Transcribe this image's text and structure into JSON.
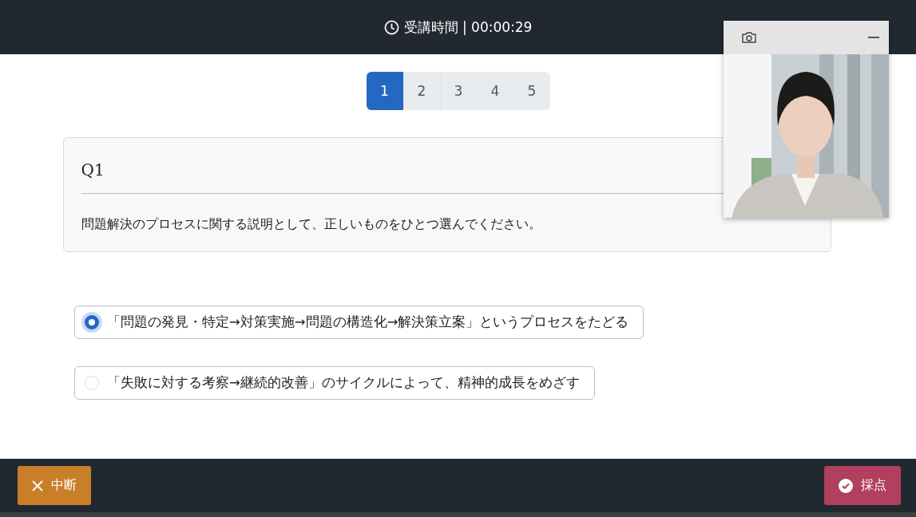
{
  "header": {
    "timer": "受講時間 | 00:00:29"
  },
  "pagination": [
    {
      "label": "1",
      "selected": true
    },
    {
      "label": "2",
      "selected": false
    },
    {
      "label": "3",
      "selected": false
    },
    {
      "label": "4",
      "selected": false
    },
    {
      "label": "5",
      "selected": false
    }
  ],
  "question": {
    "title": "Q1",
    "text": "問題解決のプロセスに関する説明として、正しいものをひとつ選んでください。"
  },
  "options": [
    {
      "text": "「問題の発見・特定→対策実施→問題の構造化→解決策立案」というプロセスをたどる",
      "selected": true
    },
    {
      "text": "「失敗に対する考察→継続的改善」のサイクルによって、精神的成長をめざす",
      "selected": false
    }
  ],
  "footer": {
    "buttons": [
      {
        "label": "中断",
        "kind": "abort"
      },
      {
        "label": "採点",
        "kind": "grade"
      }
    ]
  }
}
